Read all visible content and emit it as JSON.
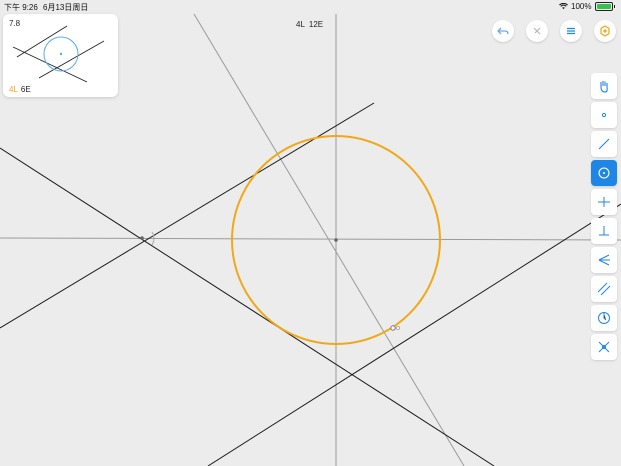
{
  "status_bar": {
    "time": "下午 9:26",
    "date": "6月13日周日",
    "battery": "100%"
  },
  "level": {
    "number": "7.8",
    "goal_lines": "4L",
    "goal_euclid": "6E"
  },
  "move_counter": {
    "lines": "4L",
    "euclid": "12E"
  },
  "top_buttons": [
    "undo-icon",
    "redo-icon",
    "menu-icon",
    "hint-icon"
  ],
  "tools": [
    {
      "name": "tool-move",
      "icon": "hand-icon",
      "active": false
    },
    {
      "name": "tool-point",
      "icon": "point-icon",
      "active": false
    },
    {
      "name": "tool-line",
      "icon": "line-icon",
      "active": false
    },
    {
      "name": "tool-circle",
      "icon": "circle-icon",
      "active": true
    },
    {
      "name": "tool-perpendicular-bisector",
      "icon": "perpendicular-bisector-icon",
      "active": false
    },
    {
      "name": "tool-perpendicular",
      "icon": "perpendicular-icon",
      "active": false
    },
    {
      "name": "tool-angle-bisector",
      "icon": "angle-bisector-icon",
      "active": false
    },
    {
      "name": "tool-parallel",
      "icon": "parallel-icon",
      "active": false
    },
    {
      "name": "tool-compass",
      "icon": "compass-icon",
      "active": false
    },
    {
      "name": "tool-intersect",
      "icon": "intersect-icon",
      "active": false
    }
  ],
  "colors": {
    "accent": "#1f86e6",
    "solution": "#f0a818",
    "given_line": "#1a1a1a",
    "construction_line": "#9a9a9a",
    "background": "#ececec"
  }
}
